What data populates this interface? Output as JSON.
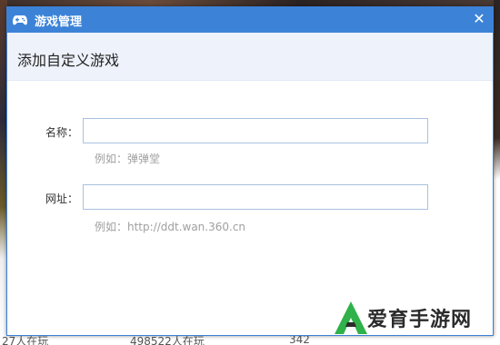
{
  "dialog": {
    "title": "游戏管理",
    "close_label": "✕",
    "heading": "添加自定义游戏",
    "fields": {
      "name": {
        "label": "名称：",
        "value": "",
        "hint": "例如：弹弹堂"
      },
      "url": {
        "label": "网址：",
        "value": "",
        "hint": "例如：http://ddt.wan.360.cn"
      }
    }
  },
  "background": {
    "bottom_texts": [
      "27人在玩",
      "498522人在玩",
      "342"
    ]
  },
  "watermark": {
    "brand": "爱育手游网",
    "logo_color": "#2fb24a",
    "text_color": "#2b2b2b"
  },
  "colors": {
    "titlebar": "#3c83d8",
    "header_bg": "#eef2fb",
    "input_border": "#a9c1e0",
    "hint": "#a0a0a0"
  }
}
